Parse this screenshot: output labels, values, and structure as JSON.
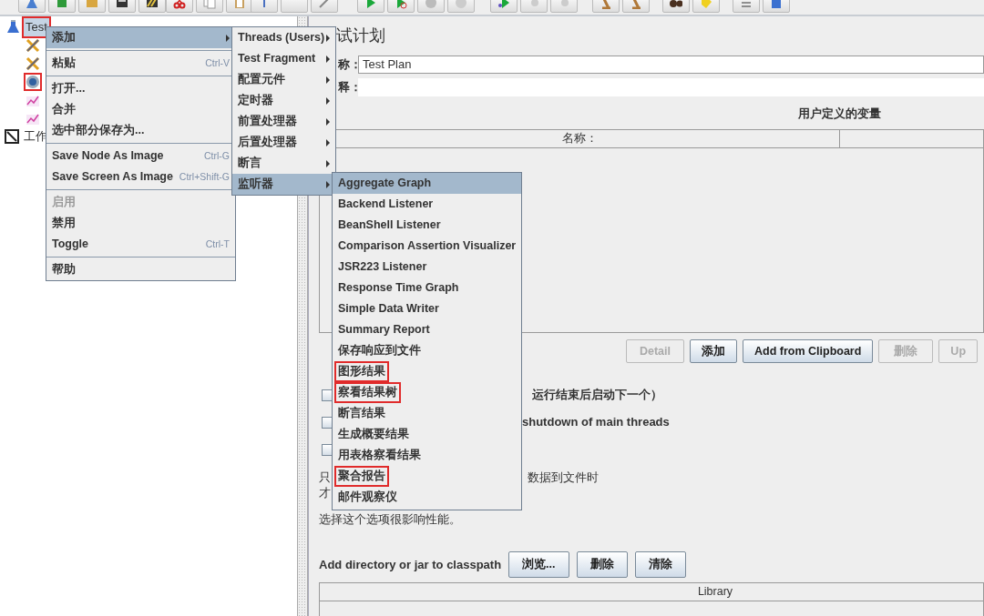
{
  "tree": [
    {
      "label": "Test",
      "kind": "plan",
      "selected": true,
      "marked": true,
      "children": [
        {
          "kind": "tool",
          "selected": false,
          "marked": false
        },
        {
          "kind": "tool",
          "selected": false,
          "marked": false
        },
        {
          "kind": "gear",
          "selected": false,
          "marked": true
        },
        {
          "kind": "graph",
          "selected": false,
          "marked": false
        },
        {
          "kind": "graph",
          "selected": false,
          "marked": false
        }
      ]
    },
    {
      "label": "工作",
      "kind": "workbench",
      "selected": false,
      "marked": false
    }
  ],
  "context_menu": {
    "groups": [
      [
        {
          "label": "添加",
          "selected": true,
          "disabled": false,
          "has_submenu": true
        }
      ],
      [
        {
          "label": "粘贴",
          "shortcut": "Ctrl-V",
          "selected": false,
          "disabled": false,
          "has_submenu": false
        }
      ],
      [
        {
          "label": "打开...",
          "selected": false,
          "disabled": false,
          "has_submenu": false
        },
        {
          "label": "合并",
          "selected": false,
          "disabled": false,
          "has_submenu": false
        },
        {
          "label": "选中部分保存为...",
          "selected": false,
          "disabled": false,
          "has_submenu": false
        }
      ],
      [
        {
          "label": "Save Node As Image",
          "shortcut": "Ctrl-G",
          "selected": false,
          "disabled": false,
          "has_submenu": false
        },
        {
          "label": "Save Screen As Image",
          "shortcut": "Ctrl+Shift-G",
          "selected": false,
          "disabled": false,
          "has_submenu": false
        }
      ],
      [
        {
          "label": "启用",
          "selected": false,
          "disabled": true,
          "has_submenu": false
        },
        {
          "label": "禁用",
          "selected": false,
          "disabled": false,
          "has_submenu": false
        },
        {
          "label": "Toggle",
          "shortcut": "Ctrl-T",
          "selected": false,
          "disabled": false,
          "has_submenu": false
        }
      ],
      [
        {
          "label": "帮助",
          "selected": false,
          "disabled": false,
          "has_submenu": false
        }
      ]
    ]
  },
  "add_submenu": {
    "items": [
      {
        "label": "Threads (Users)",
        "selected": false,
        "has_submenu": true
      },
      {
        "label": "Test Fragment",
        "selected": false,
        "has_submenu": true
      },
      {
        "label": "配置元件",
        "selected": false,
        "has_submenu": true
      },
      {
        "label": "定时器",
        "selected": false,
        "has_submenu": true
      },
      {
        "label": "前置处理器",
        "selected": false,
        "has_submenu": true
      },
      {
        "label": "后置处理器",
        "selected": false,
        "has_submenu": true
      },
      {
        "label": "断言",
        "selected": false,
        "has_submenu": true
      },
      {
        "label": "监听器",
        "selected": true,
        "has_submenu": true
      }
    ]
  },
  "listener_submenu": {
    "items": [
      {
        "label": "Aggregate Graph",
        "selected": true,
        "marked": false
      },
      {
        "label": "Backend Listener",
        "selected": false,
        "marked": false
      },
      {
        "label": "BeanShell Listener",
        "selected": false,
        "marked": false
      },
      {
        "label": "Comparison Assertion Visualizer",
        "selected": false,
        "marked": false
      },
      {
        "label": "JSR223 Listener",
        "selected": false,
        "marked": false
      },
      {
        "label": "Response Time Graph",
        "selected": false,
        "marked": false
      },
      {
        "label": "Simple Data Writer",
        "selected": false,
        "marked": false
      },
      {
        "label": "Summary Report",
        "selected": false,
        "marked": false
      },
      {
        "label": "保存响应到文件",
        "selected": false,
        "marked": false
      },
      {
        "label": "图形结果",
        "selected": false,
        "marked": true
      },
      {
        "label": "察看结果树",
        "selected": false,
        "marked": true
      },
      {
        "label": "断言结果",
        "selected": false,
        "marked": false
      },
      {
        "label": "生成概要结果",
        "selected": false,
        "marked": false
      },
      {
        "label": "用表格察看结果",
        "selected": false,
        "marked": false
      },
      {
        "label": "聚合报告",
        "selected": false,
        "marked": true
      },
      {
        "label": "邮件观察仪",
        "selected": false,
        "marked": false
      }
    ]
  },
  "test_plan": {
    "title": "试计划",
    "name_label": "称：",
    "name_value": "Test Plan",
    "comment_label": "释：",
    "variables": {
      "title": "用户定义的变量",
      "columns": [
        "名称："
      ]
    },
    "buttons": [
      {
        "label": "Detail",
        "disabled": true
      },
      {
        "label": "添加",
        "disabled": false
      },
      {
        "label": "Add from Clipboard",
        "disabled": false
      },
      {
        "label": "删除",
        "disabled": true
      },
      {
        "label": "Up",
        "disabled": true
      }
    ],
    "options": [
      {
        "text": "运行结束后启动下一个）",
        "checked": false
      },
      {
        "text": "shutdown of main threads",
        "checked": false
      },
      {
        "checked": false
      }
    ],
    "note_lines": [
      {
        "start": "只",
        "end": "数据到文件时"
      },
      {
        "start": "才"
      }
    ],
    "note": "选择这个选项很影响性能。",
    "classpath_label": "Add directory or jar to classpath",
    "classpath_buttons": [
      "浏览...",
      "删除",
      "清除"
    ],
    "library_column": "Library"
  }
}
